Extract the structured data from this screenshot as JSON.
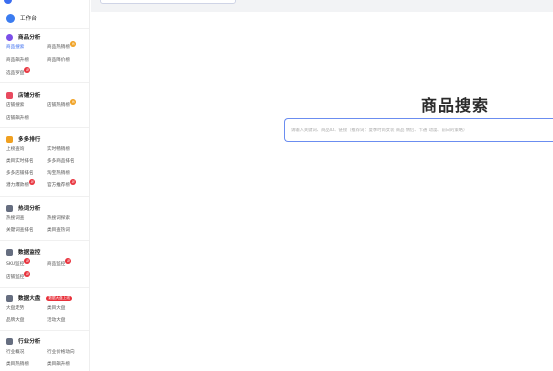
{
  "sidebar": {
    "workbench": "工作台",
    "sections": [
      {
        "title": "商品分析",
        "color": "#7b4fe8",
        "items": [
          {
            "label": "商品搜索",
            "active": true
          },
          {
            "label": "商品热销榜",
            "badge": "热"
          },
          {
            "label": "商品飙升榜"
          },
          {
            "label": "商品降价榜"
          },
          {
            "label": "选品罗盘",
            "badge": "新"
          }
        ]
      },
      {
        "title": "店铺分析",
        "color": "#e84a5f",
        "items": [
          {
            "label": "店铺搜索"
          },
          {
            "label": "店铺热销榜",
            "badge": "热"
          },
          {
            "label": "店铺飙升榜"
          }
        ]
      },
      {
        "title": "多多排行",
        "color": "#f0a020",
        "items": [
          {
            "label": "上榜查询"
          },
          {
            "label": "实时畅销榜"
          },
          {
            "label": "类目实时排名"
          },
          {
            "label": "多多商品排名"
          },
          {
            "label": "多多店铺排名"
          },
          {
            "label": "淘宝热销榜"
          },
          {
            "label": "潜力爆款榜",
            "badge": "新"
          },
          {
            "label": "官方推荐榜",
            "badge": "新"
          }
        ]
      },
      {
        "title": "热词分析",
        "color": "#666e80",
        "items": [
          {
            "label": "热搜词查"
          },
          {
            "label": "热搜词探索"
          },
          {
            "label": "关键词查排名"
          },
          {
            "label": "类目查热词"
          }
        ]
      },
      {
        "title": "数据监控",
        "color": "#666e80",
        "items": [
          {
            "label": "SKU监控",
            "badge": "新"
          },
          {
            "label": "商品监控",
            "badge": "新"
          },
          {
            "label": "店铺监控",
            "badge": "新"
          }
        ]
      },
      {
        "title": "数据大盘",
        "color": "#666e80",
        "new_badge": "数据大盘上线",
        "items": [
          {
            "label": "大盘走势"
          },
          {
            "label": "类目大盘"
          },
          {
            "label": "品牌大盘"
          },
          {
            "label": "活动大盘"
          }
        ]
      },
      {
        "title": "行业分析",
        "color": "#666e80",
        "items": [
          {
            "label": "行业概况"
          },
          {
            "label": "行业价格动向"
          },
          {
            "label": "类目热销榜"
          },
          {
            "label": "类目飙升榜"
          }
        ]
      }
    ]
  },
  "main": {
    "title": "商品搜索",
    "search_placeholder": "请输入关键词、商品ID、链接（推荐词：夏季时尚女装 商品 情侣、卡通 动漫、前日的策略）"
  },
  "colors": {
    "accent": "#3b6df0",
    "badge_hot": "#f0a020",
    "badge_new": "#e8303a"
  }
}
